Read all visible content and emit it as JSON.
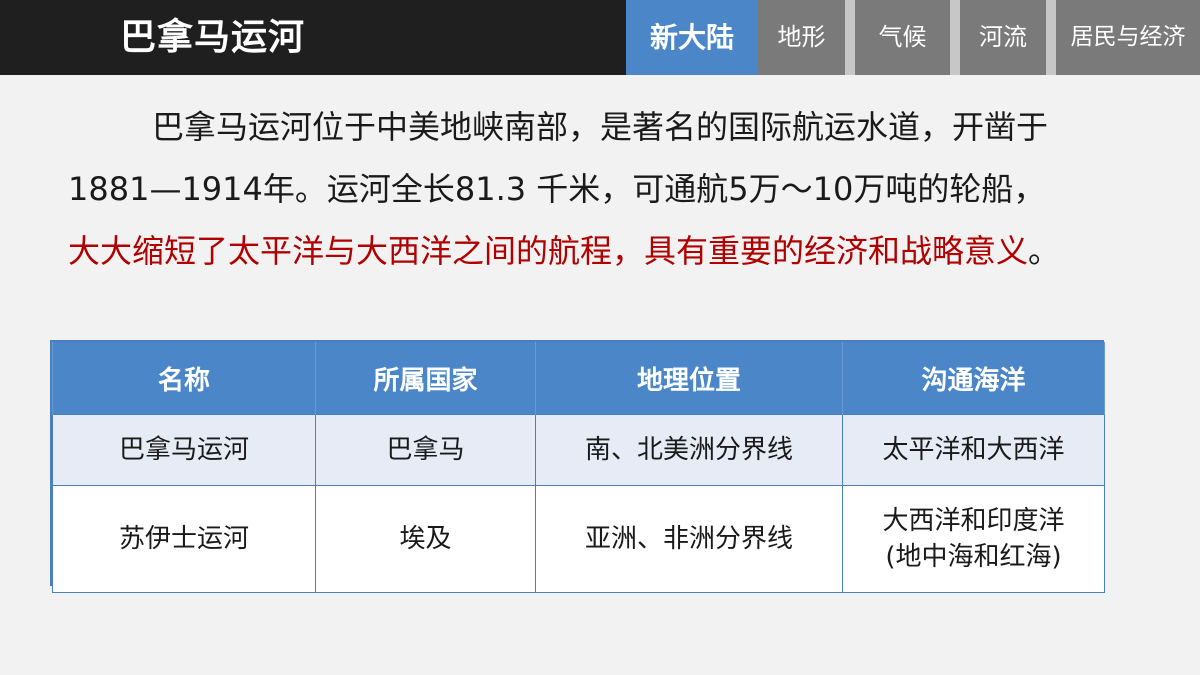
{
  "header": {
    "title": "巴拿马运河",
    "tabs": [
      {
        "label": "新大陆",
        "active": true
      },
      {
        "label": "地形",
        "active": false
      },
      {
        "label": "气候",
        "active": false
      },
      {
        "label": "河流",
        "active": false
      },
      {
        "label": "居民与经济",
        "active": false
      }
    ]
  },
  "paragraph": {
    "line1": "巴拿马运河位于中美地峡南部，是著名的国际航运水道，开凿于",
    "line2": "1881—1914年。运河全长81.3 千米，可通航5万～10万吨的轮船，",
    "line3_highlight": "大大缩短了太平洋与大西洋之间的航程，具有重要的经济和战略意义",
    "line3_end": "。"
  },
  "table": {
    "headers": [
      "名称",
      "所属国家",
      "地理位置",
      "沟通海洋"
    ],
    "rows": [
      {
        "name": "巴拿马运河",
        "country": "巴拿马",
        "location": "南、北美洲分界线",
        "oceans_line1": "太平洋和大西洋",
        "oceans_line2": ""
      },
      {
        "name": "苏伊士运河",
        "country": "埃及",
        "location": "亚洲、非洲分界线",
        "oceans_line1": "大西洋和印度洋",
        "oceans_line2": "(地中海和红海)"
      }
    ]
  },
  "colors": {
    "header_bg": "#1f1f1f",
    "active_tab": "#4a86c8",
    "inactive_tab": "#7a7a7a",
    "highlight_text": "#b00000",
    "table_header": "#4a86c8"
  }
}
